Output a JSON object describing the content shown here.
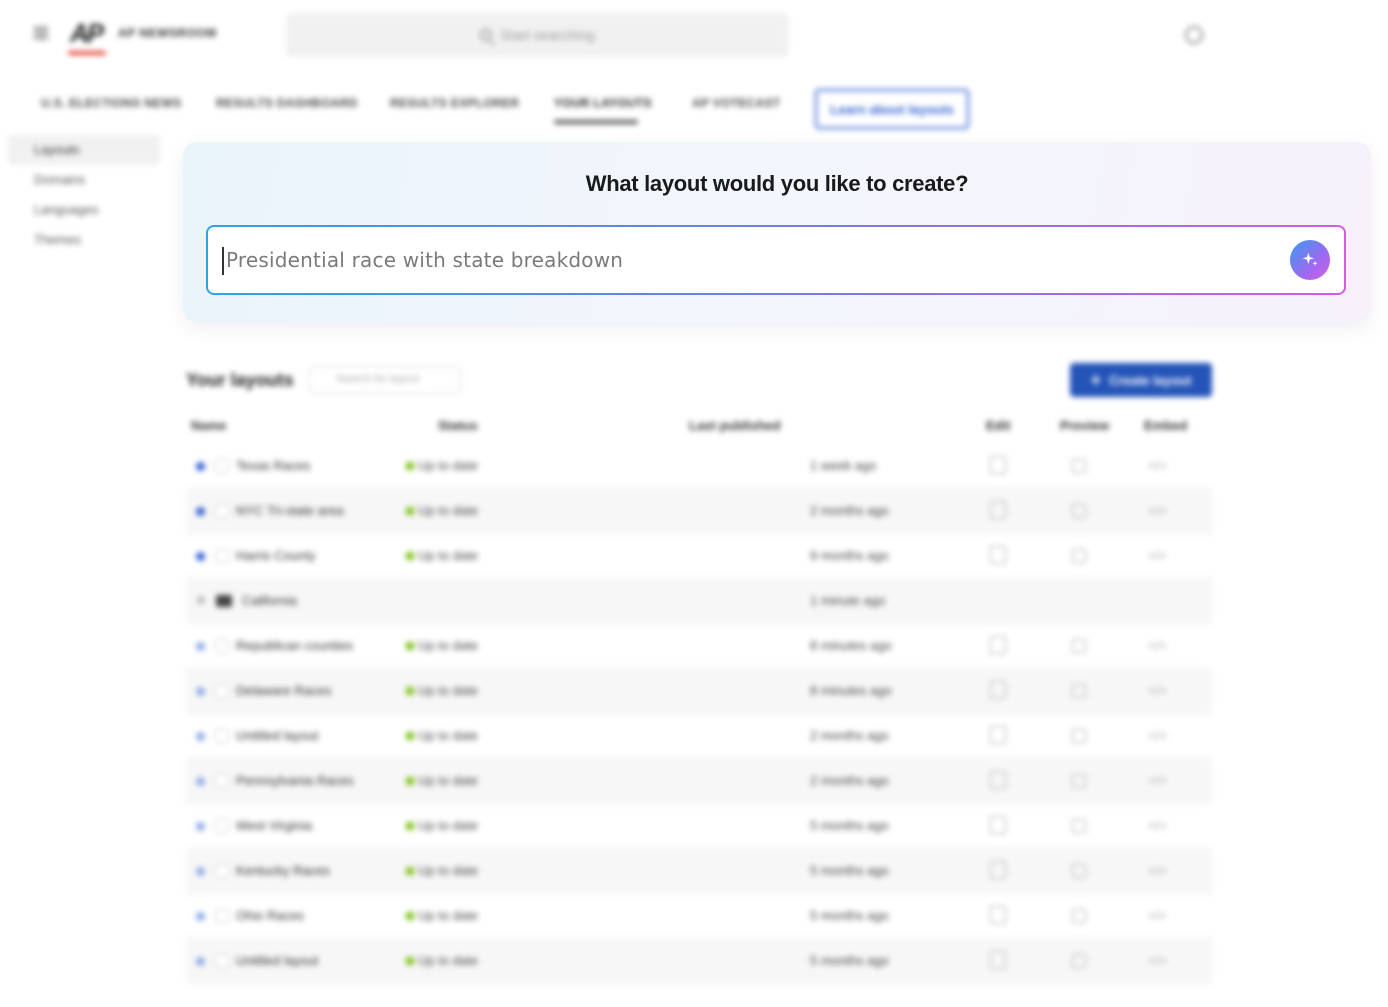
{
  "app": {
    "brand": "AP NEWSROOM",
    "logo": "AP"
  },
  "search": {
    "placeholder": "Start searching"
  },
  "tabs": [
    {
      "label": "U.S. ELECTIONS NEWS"
    },
    {
      "label": "RESULTS DASHBOARD"
    },
    {
      "label": "RESULTS EXPLORER"
    },
    {
      "label": "YOUR LAYOUTS",
      "active": true
    },
    {
      "label": "AP VOTECAST"
    }
  ],
  "learn_button": "Learn about layouts",
  "sidebar": {
    "items": [
      {
        "label": "Layouts",
        "active": true
      },
      {
        "label": "Domains"
      },
      {
        "label": "Languages"
      },
      {
        "label": "Themes"
      }
    ]
  },
  "ai_panel": {
    "title": "What layout would you like to create?",
    "input_placeholder": "Presidential race with state breakdown"
  },
  "layouts": {
    "title": "Your layouts",
    "search_placeholder": "Search for layout",
    "create_label": "Create layout",
    "columns": [
      "Name",
      "Status",
      "Last published",
      "Edit",
      "Preview",
      "Embed"
    ],
    "rows": [
      {
        "name": "Texas Races",
        "status": "Up to date",
        "published": "1 week ago"
      },
      {
        "name": "NYC Tri-state area",
        "status": "Up to date",
        "published": "2 months ago"
      },
      {
        "name": "Harris County",
        "status": "Up to date",
        "published": "9 months ago"
      },
      {
        "name": "California",
        "status": "",
        "published": "1 minute ago",
        "folder": true
      },
      {
        "name": "Republican counties",
        "status": "Up to date",
        "published": "8 minutes ago"
      },
      {
        "name": "Delaware Races",
        "status": "Up to date",
        "published": "8 minutes ago"
      },
      {
        "name": "Untitled layout",
        "status": "Up to date",
        "published": "2 months ago"
      },
      {
        "name": "Pennsylvania Races",
        "status": "Up to date",
        "published": "2 months ago"
      },
      {
        "name": "West Virginia",
        "status": "Up to date",
        "published": "5 months ago"
      },
      {
        "name": "Kentucky Races",
        "status": "Up to date",
        "published": "5 months ago"
      },
      {
        "name": "Ohio Races",
        "status": "Up to date",
        "published": "5 months ago"
      },
      {
        "name": "Untitled layout",
        "status": "Up to date",
        "published": "5 months ago"
      }
    ]
  },
  "colors": {
    "accent": "#2454b8",
    "status_ok": "#7ec21a",
    "brand_red": "#e4473a"
  }
}
